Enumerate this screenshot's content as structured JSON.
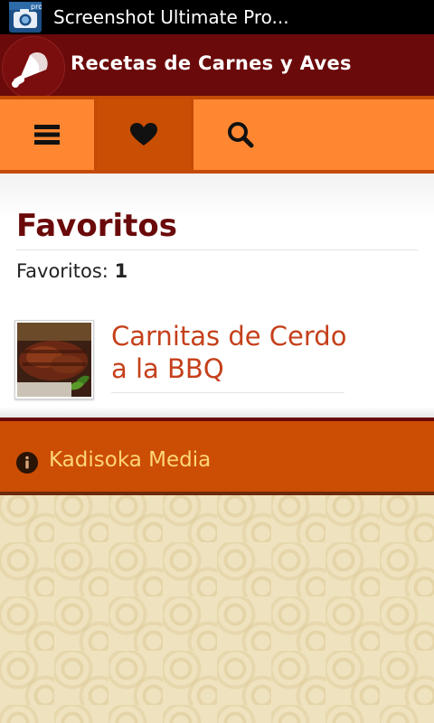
{
  "status_bar": {
    "notification_text": "Screenshot Ultimate Pro...",
    "badge": "pro",
    "icon": "camera-icon"
  },
  "header": {
    "title": "Recetas de Carnes y Aves",
    "logo_icon": "meat-logo-icon"
  },
  "toolbar": {
    "items": [
      {
        "icon": "menu-icon",
        "active": false
      },
      {
        "icon": "heart-icon",
        "active": true
      },
      {
        "icon": "search-icon",
        "active": false
      }
    ]
  },
  "main": {
    "page_title": "Favoritos",
    "count_label": "Favoritos:",
    "count_value": "1",
    "recipes": [
      {
        "name": "Carnitas de Cerdo a la BBQ"
      }
    ]
  },
  "footer": {
    "text": "Kadisoka Media",
    "icon": "info-icon"
  },
  "colors": {
    "header_bg": "#6b0a0a",
    "toolbar_bg": "#ff8731",
    "toolbar_active": "#c94f04",
    "recipe_link": "#c5401b",
    "footer_bg": "#cc4d04",
    "footer_text": "#ffd678"
  }
}
